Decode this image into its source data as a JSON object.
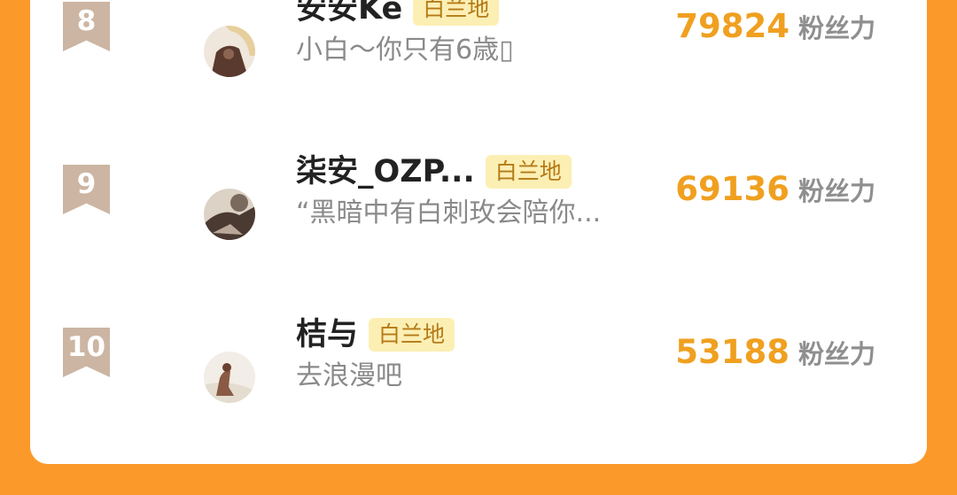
{
  "leaderboard": {
    "entries": [
      {
        "rank": "8",
        "name": "安安Ke",
        "badge": "白兰地",
        "signature": "小白～你只有6歳▯",
        "fans_value": "79824",
        "fans_unit": "粉丝力"
      },
      {
        "rank": "9",
        "name": "柒安_OZP...",
        "badge": "白兰地",
        "signature": "“黑暗中有白刺玫会陪你...",
        "fans_value": "69136",
        "fans_unit": "粉丝力"
      },
      {
        "rank": "10",
        "name": "桔与",
        "badge": "白兰地",
        "signature": "去浪漫吧",
        "fans_value": "53188",
        "fans_unit": "粉丝力"
      }
    ]
  },
  "colors": {
    "page_background": "#fb9a2a",
    "card_background": "#ffffff",
    "rank_ribbon": "#ccb5a2",
    "fans_value": "#f0a020",
    "badge_background": "#fcefb4",
    "badge_text": "#b47a16"
  }
}
